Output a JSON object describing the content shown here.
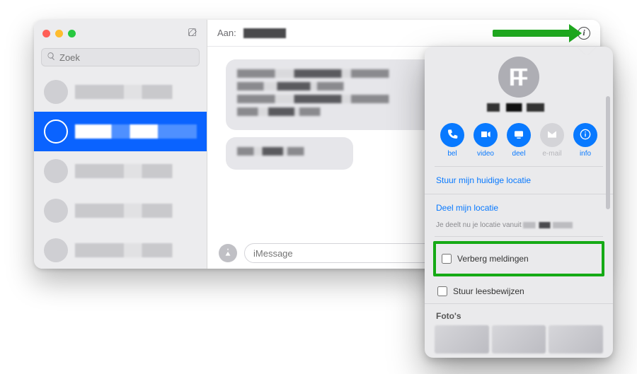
{
  "sidebar": {
    "search_placeholder": "Zoek"
  },
  "header": {
    "to_label": "Aan:"
  },
  "compose": {
    "placeholder": "iMessage"
  },
  "popover": {
    "actions": {
      "call": "bel",
      "video": "video",
      "share": "deel",
      "email": "e-mail",
      "info": "info"
    },
    "send_current_location": "Stuur mijn huidige locatie",
    "share_location": "Deel mijn locatie",
    "sharing_note_prefix": "Je deelt nu je locatie vanuit ",
    "hide_alerts": "Verberg meldingen",
    "send_read_receipts": "Stuur leesbewijzen",
    "photos_title": "Foto's"
  }
}
